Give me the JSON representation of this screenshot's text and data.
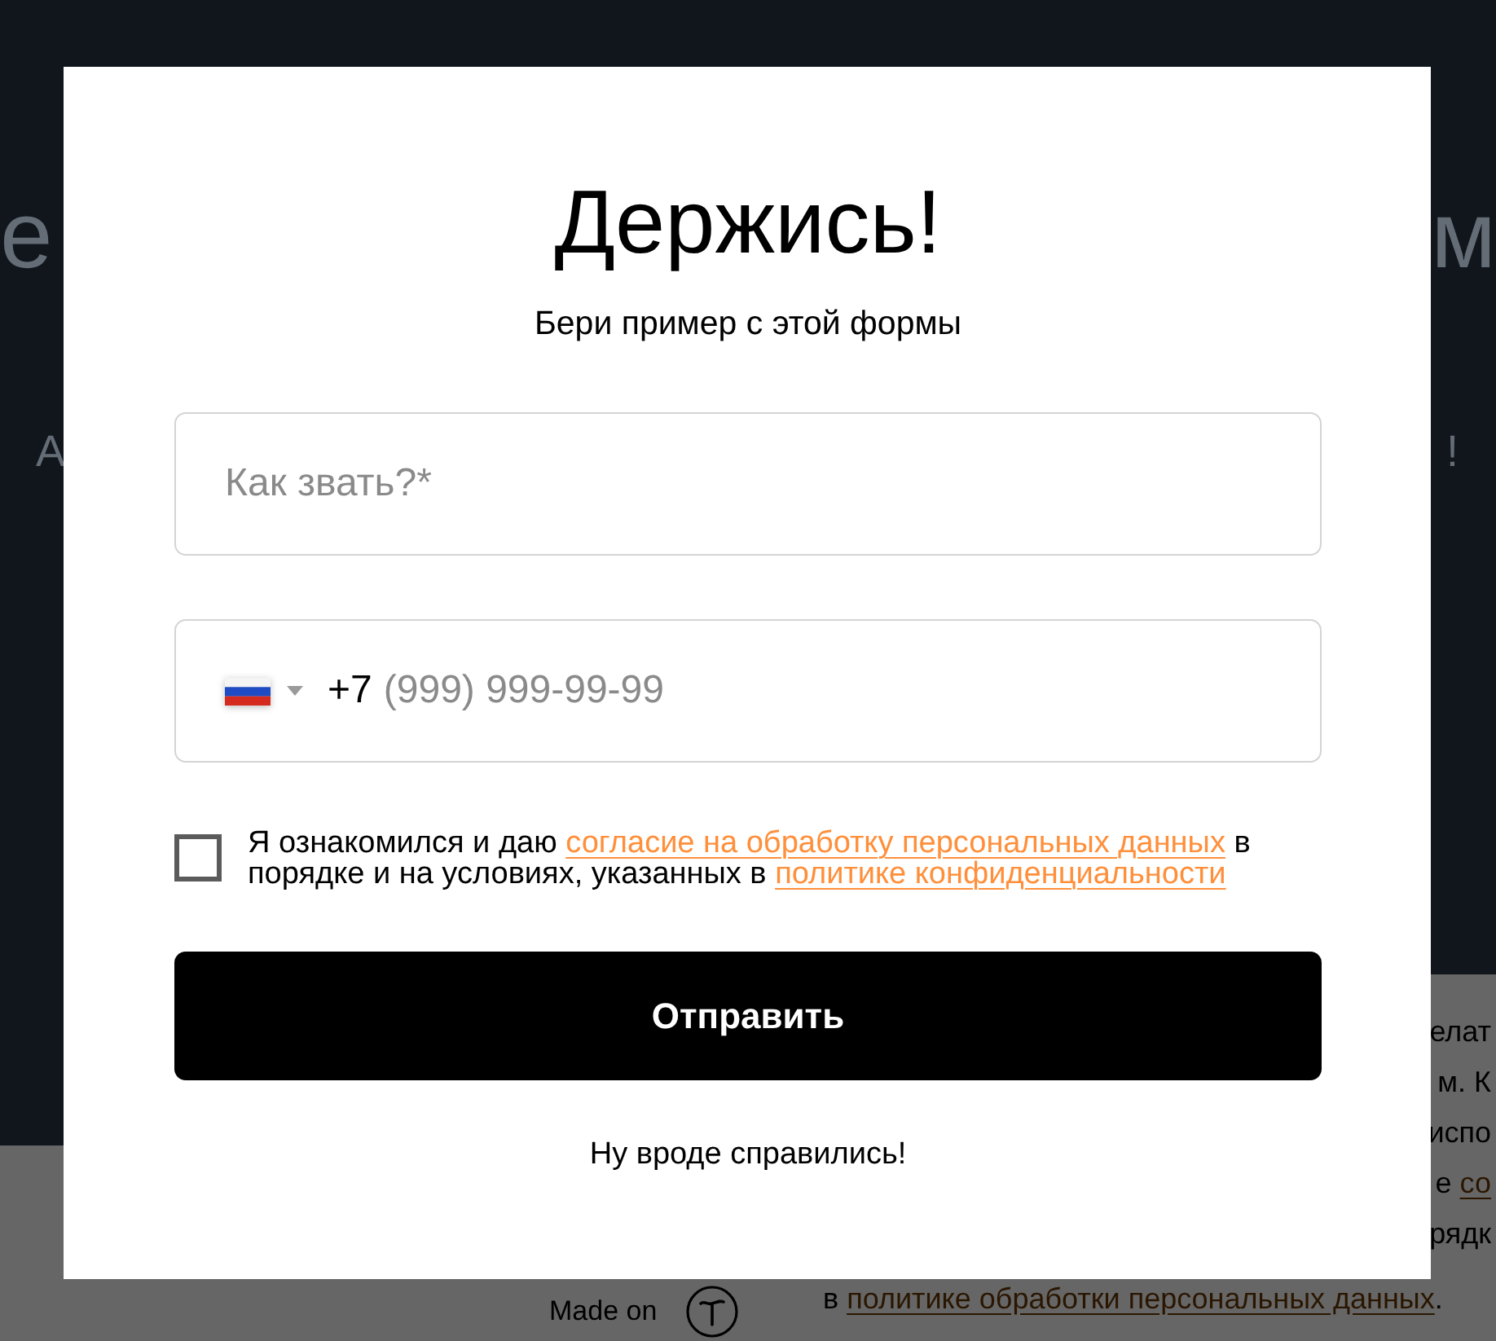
{
  "backdrop": {
    "hero": {
      "heading_fragments": [
        "е",
        "м"
      ],
      "subtitle_fragments": [
        "А",
        "!"
      ]
    },
    "side_panel": {
      "lines": [
        {
          "kind": "edge",
          "segments": [
            {
              "kind": "text",
              "text": "елат"
            }
          ]
        },
        {
          "kind": "edge",
          "segments": [
            {
              "kind": "text",
              "text": "м. К"
            }
          ]
        },
        {
          "kind": "edge",
          "segments": [
            {
              "kind": "text",
              "text": "испо"
            }
          ]
        },
        {
          "kind": "edge",
          "segments": [
            {
              "kind": "text",
              "text": "е "
            },
            {
              "kind": "link",
              "text": "со"
            }
          ]
        },
        {
          "kind": "edge",
          "segments": [
            {
              "kind": "text",
              "text": "рядк"
            }
          ]
        },
        {
          "kind": "full",
          "segments": [
            {
              "kind": "text",
              "text": "в "
            },
            {
              "kind": "link",
              "text": "политике обработки персональных данных"
            },
            {
              "kind": "text",
              "text": "."
            }
          ]
        }
      ]
    },
    "footer": {
      "label": "Made on"
    }
  },
  "modal": {
    "title": "Держись!",
    "subtitle": "Бери пример с этой формы",
    "fields": [
      {
        "kind": "text",
        "placeholder": "Как звать?*"
      },
      {
        "kind": "phone",
        "country_code": "+7",
        "placeholder": "(999) 999-99-99"
      }
    ],
    "consent": {
      "checked": false,
      "segments": [
        {
          "kind": "text",
          "text": "Я ознакомился и даю "
        },
        {
          "kind": "link",
          "text": "согласие на обработку персональных данных"
        },
        {
          "kind": "text",
          "text": " в порядке и на условиях, указанных в "
        },
        {
          "kind": "link",
          "text": "политике конфиденциальности"
        }
      ]
    },
    "submit_button": "Отправить",
    "note": "Ну вроде справились!"
  }
}
